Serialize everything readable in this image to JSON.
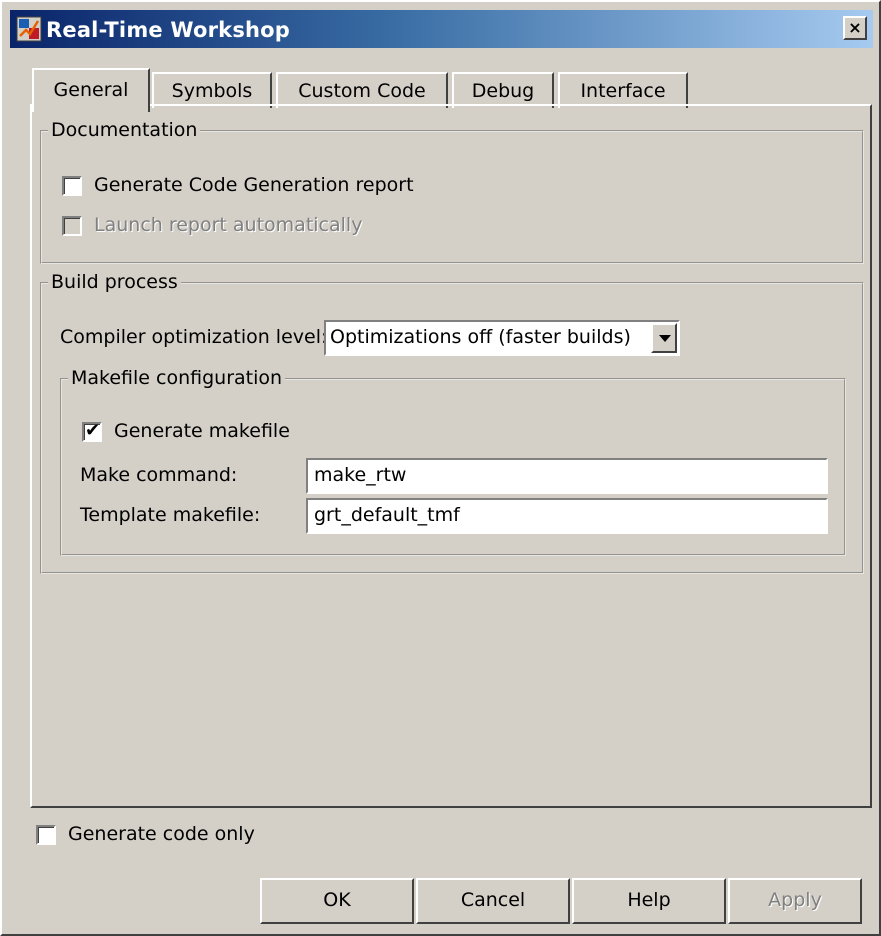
{
  "window": {
    "title": "Real-Time Workshop",
    "close_glyph": "×",
    "app_icon": "simulink-icon"
  },
  "tabs": [
    {
      "label": "General",
      "active": true
    },
    {
      "label": "Symbols",
      "active": false
    },
    {
      "label": "Custom Code",
      "active": false
    },
    {
      "label": "Debug",
      "active": false
    },
    {
      "label": "Interface",
      "active": false
    }
  ],
  "documentation": {
    "title": "Documentation",
    "generate_report": {
      "label": "Generate Code Generation report",
      "checked": false
    },
    "launch_report": {
      "label": "Launch report automatically",
      "checked": false,
      "enabled": false
    }
  },
  "build_process": {
    "title": "Build process",
    "optimization_label": "Compiler optimization level:",
    "optimization_value": "Optimizations off (faster builds)",
    "makefile": {
      "title": "Makefile configuration",
      "generate_makefile": {
        "label": "Generate makefile",
        "checked": true,
        "check_glyph": "✔"
      },
      "make_command_label": "Make command:",
      "make_command_value": "make_rtw",
      "template_label": "Template makefile:",
      "template_value": "grt_default_tmf"
    }
  },
  "generate_code_only": {
    "label": "Generate code only",
    "checked": false
  },
  "buttons": {
    "ok": "OK",
    "cancel": "Cancel",
    "help": "Help",
    "apply": "Apply"
  },
  "colors": {
    "face": "#d4d0c8",
    "title_start": "#0a246a",
    "title_end": "#a6caf0",
    "disabled_text": "#808080"
  }
}
